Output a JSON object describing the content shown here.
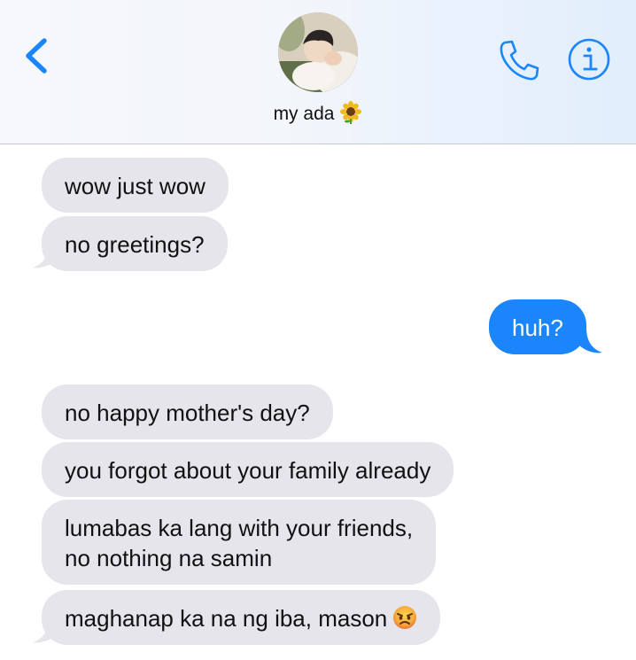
{
  "header": {
    "contact_name": "my ada",
    "contact_emoji": "sunflower-icon"
  },
  "messages": [
    {
      "direction": "incoming",
      "text": "wow just wow"
    },
    {
      "direction": "incoming",
      "text": "no greetings?"
    },
    {
      "direction": "outgoing",
      "text": "huh?"
    },
    {
      "direction": "incoming",
      "text": "no happy mother's day?"
    },
    {
      "direction": "incoming",
      "text": "you forgot about your family already"
    },
    {
      "direction": "incoming",
      "lines": [
        "lumabas ka lang with your friends,",
        "no nothing na samin"
      ]
    },
    {
      "direction": "incoming",
      "text": "maghanap ka na ng iba, mason",
      "trailing_emoji": "pouting-face-icon"
    }
  ],
  "colors": {
    "accent": "#1b86fb",
    "incoming_bubble": "#e6e5eb",
    "outgoing_text": "#ffffff"
  }
}
